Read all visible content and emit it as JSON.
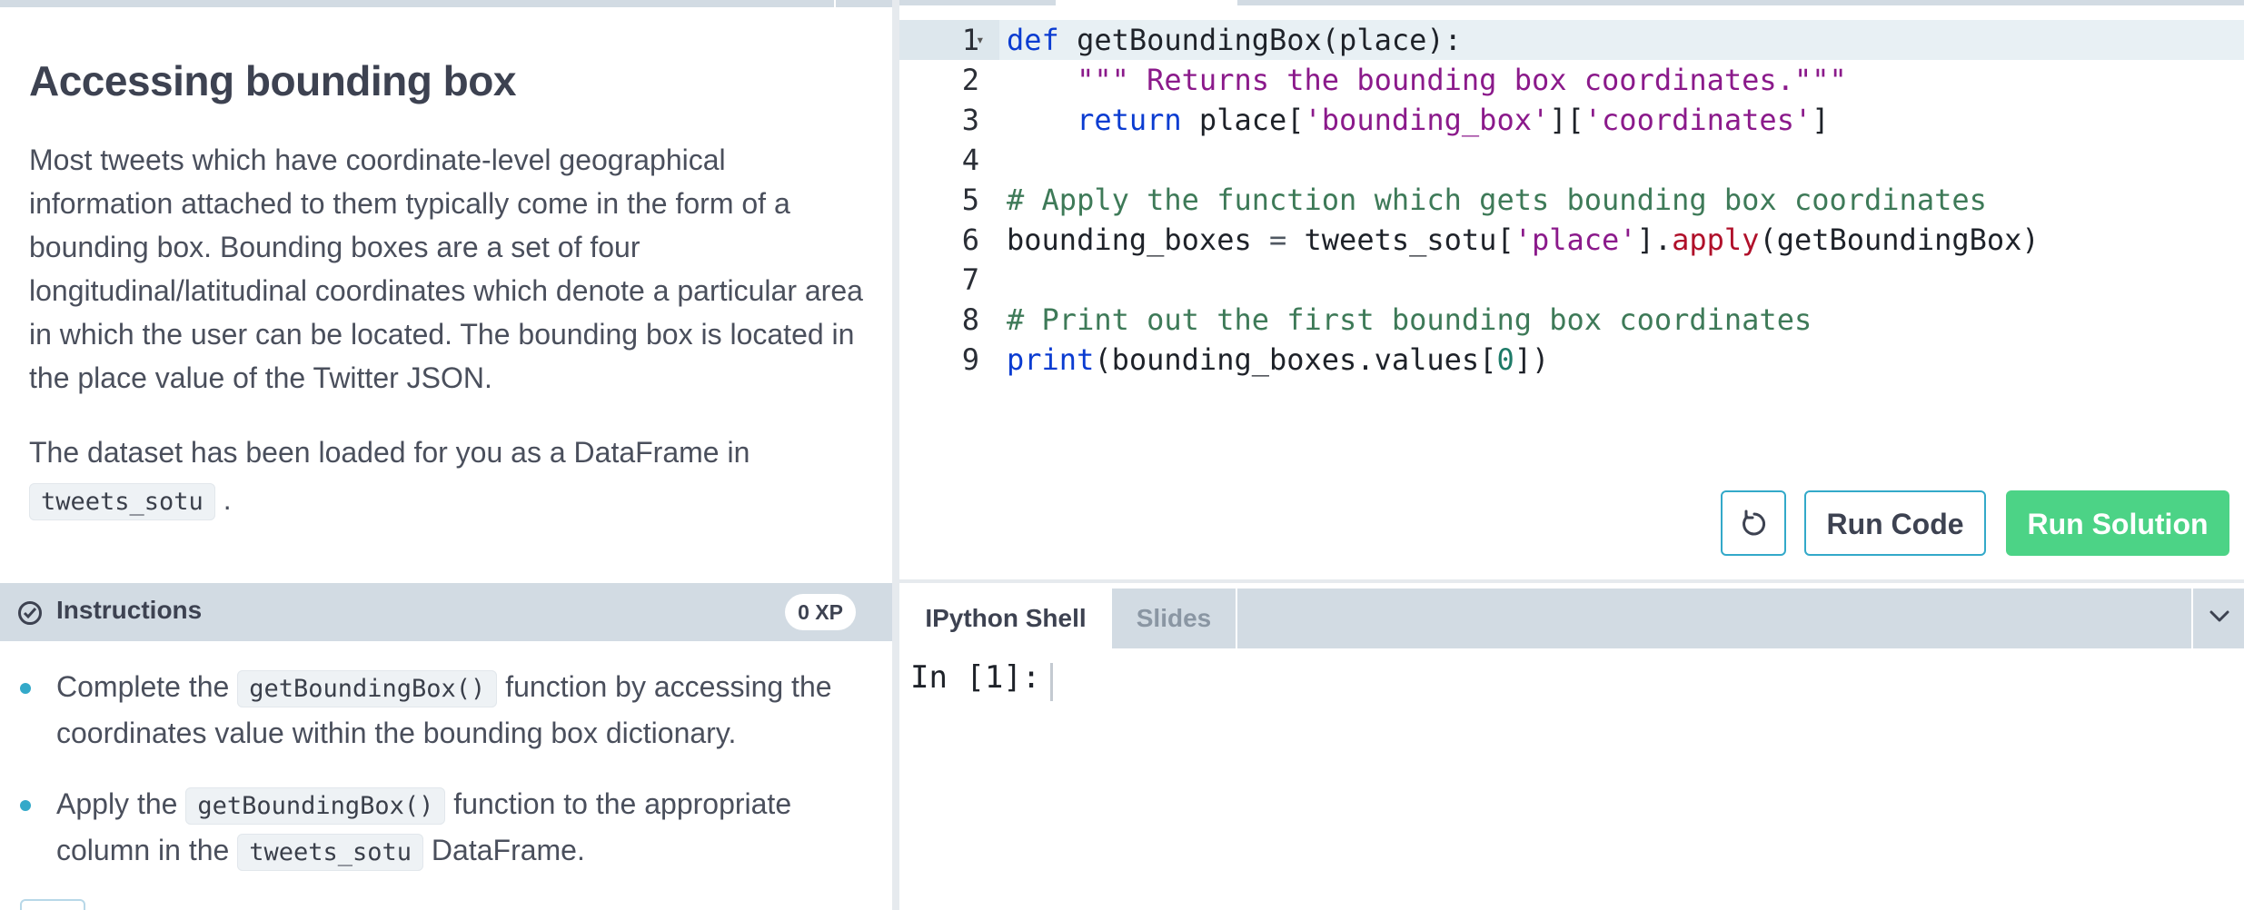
{
  "context": {
    "title": "Accessing bounding box",
    "paragraph1": "Most tweets which have coordinate-level geographical information attached to them typically come in the form of a bounding box. Bounding boxes are a set of four longitudinal/latitudinal coordinates which denote a particular area in which the user can be located. The bounding box is located in the place value of the Twitter JSON.",
    "paragraph2_prefix": "The dataset has been loaded for you as a DataFrame in",
    "paragraph2_code": "tweets_sotu",
    "paragraph2_suffix": "."
  },
  "instructions": {
    "label": "Instructions",
    "xp": "0 XP",
    "items": [
      {
        "before": "Complete the",
        "code": "getBoundingBox()",
        "after": "function by accessing the coordinates value within the bounding box dictionary."
      },
      {
        "before": "Apply the",
        "code": "getBoundingBox()",
        "after": "function to the appropriate column in the",
        "code2": "tweets_sotu",
        "after2": "DataFrame."
      }
    ]
  },
  "editor": {
    "line_numbers": [
      "1",
      "2",
      "3",
      "4",
      "5",
      "6",
      "7",
      "8",
      "9"
    ],
    "active_line": 1,
    "tokens": {
      "l1_kw": "def",
      "l1_rest": " getBoundingBox(place):",
      "l2_str": "\"\"\" Returns the bounding box coordinates.\"\"\"",
      "l3_kw": "return",
      "l3_a": " place[",
      "l3_s1": "'bounding_box'",
      "l3_b": "][",
      "l3_s2": "'coordinates'",
      "l3_c": "]",
      "l5_cmt": "# Apply the function which gets bounding box coordinates",
      "l6_a": "bounding_boxes ",
      "l6_eq": "=",
      "l6_b": " tweets_sotu[",
      "l6_s": "'place'",
      "l6_c": "].",
      "l6_fn": "apply",
      "l6_d": "(getBoundingBox)",
      "l8_cmt": "# Print out the first bounding box coordinates",
      "l9_kw": "print",
      "l9_a": "(bounding_boxes.values[",
      "l9_num": "0",
      "l9_b": "])"
    },
    "buttons": {
      "reset_icon": "reset-icon",
      "run": "Run Code",
      "solution": "Run Solution"
    },
    "colors": {
      "run_solution_bg": "#4cd386",
      "accent": "#33a9c9"
    }
  },
  "console": {
    "tabs": [
      "IPython Shell",
      "Slides"
    ],
    "active_tab": "IPython Shell",
    "prompt": "In [1]:"
  }
}
